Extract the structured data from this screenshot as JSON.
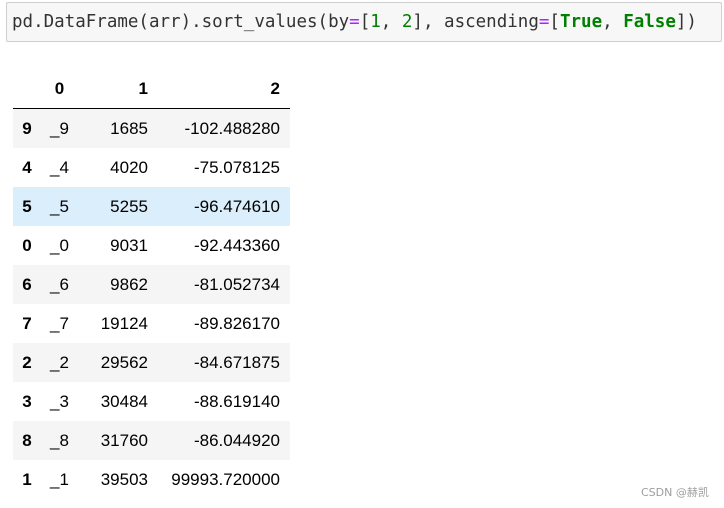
{
  "code_cell": {
    "parts": {
      "p1": "pd.DataFrame(arr).sort_values(by",
      "eq1": "=",
      "lb1": "[",
      "n1": "1",
      "sep1": ", ",
      "n2": "2",
      "rb1": "]",
      "sep2": ", ascending",
      "eq2": "=",
      "lb2": "[",
      "kw1": "True",
      "sep3": ", ",
      "kw2": "False",
      "rb2": "])"
    }
  },
  "table": {
    "columns": [
      "0",
      "1",
      "2"
    ],
    "rows": [
      {
        "index": "9",
        "c0": "_9",
        "c1": "1685",
        "c2": "-102.488280"
      },
      {
        "index": "4",
        "c0": "_4",
        "c1": "4020",
        "c2": "-75.078125"
      },
      {
        "index": "5",
        "c0": "_5",
        "c1": "5255",
        "c2": "-96.474610"
      },
      {
        "index": "0",
        "c0": "_0",
        "c1": "9031",
        "c2": "-92.443360"
      },
      {
        "index": "6",
        "c0": "_6",
        "c1": "9862",
        "c2": "-81.052734"
      },
      {
        "index": "7",
        "c0": "_7",
        "c1": "19124",
        "c2": "-89.826170"
      },
      {
        "index": "2",
        "c0": "_2",
        "c1": "29562",
        "c2": "-84.671875"
      },
      {
        "index": "3",
        "c0": "_3",
        "c1": "30484",
        "c2": "-88.619140"
      },
      {
        "index": "8",
        "c0": "_8",
        "c1": "31760",
        "c2": "-86.044920"
      },
      {
        "index": "1",
        "c0": "_1",
        "c1": "39503",
        "c2": "99993.720000"
      }
    ],
    "highlighted_row": 2
  },
  "watermark": "CSDN @赫凯",
  "colors": {
    "operator": "#aa22ff",
    "number": "#008000",
    "keyword": "#008000",
    "row_highlight": "#dbeefb",
    "row_stripe": "#f5f5f5"
  }
}
